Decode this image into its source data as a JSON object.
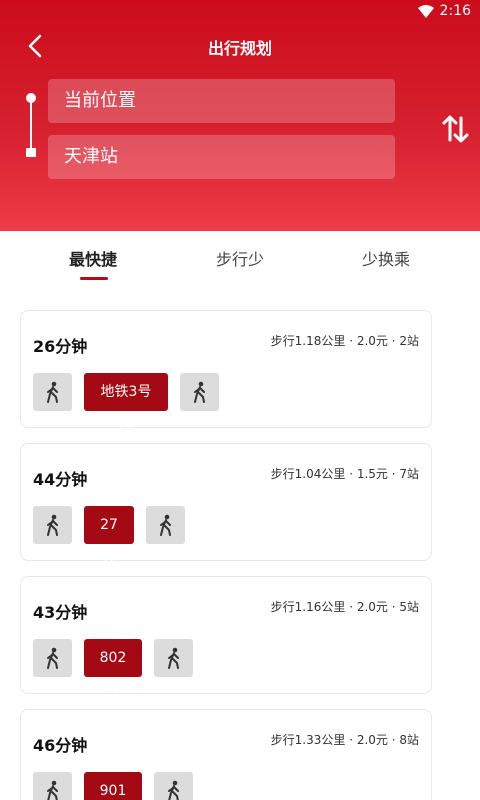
{
  "status": {
    "time": "2:16"
  },
  "header": {
    "title": "出行规划",
    "from": "当前位置",
    "to": "天津站"
  },
  "tabs": [
    {
      "label": "最快捷",
      "active": true
    },
    {
      "label": "步行少",
      "active": false
    },
    {
      "label": "少换乘",
      "active": false
    }
  ],
  "routes": [
    {
      "duration": "26分钟",
      "meta": "步行1.18公里 · 2.0元 · 2站",
      "line": "地铁3号线"
    },
    {
      "duration": "44分钟",
      "meta": "步行1.04公里 · 1.5元 · 7站",
      "line": "27路"
    },
    {
      "duration": "43分钟",
      "meta": "步行1.16公里 · 2.0元 · 5站",
      "line": "802路"
    },
    {
      "duration": "46分钟",
      "meta": "步行1.33公里 · 2.0元 · 8站",
      "line": "901路"
    }
  ],
  "colors": {
    "header": "#cc0c1c",
    "accent": "#b40d18",
    "line_badge": "#a40a14"
  },
  "icons": [
    "back-arrow-icon",
    "swap-icon",
    "wifi-icon",
    "walking-icon"
  ]
}
